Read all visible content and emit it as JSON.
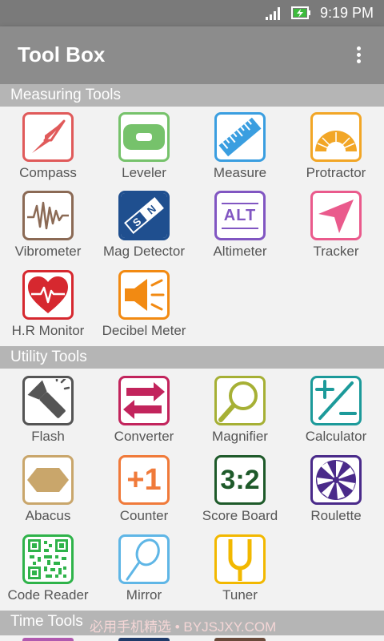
{
  "status_bar": {
    "time": "9:19 PM",
    "signal_icon": "signal-icon",
    "battery_icon": "battery-charging-icon"
  },
  "app_bar": {
    "title": "Tool Box",
    "menu_icon": "more-vert-icon"
  },
  "sections": {
    "measuring": {
      "title": "Measuring Tools",
      "items": [
        {
          "label": "Compass",
          "icon": "compass-icon",
          "color": "#e05a5a"
        },
        {
          "label": "Leveler",
          "icon": "leveler-icon",
          "color": "#76c26b"
        },
        {
          "label": "Measure",
          "icon": "ruler-icon",
          "color": "#3a9ee0"
        },
        {
          "label": "Protractor",
          "icon": "protractor-icon",
          "color": "#f2a626"
        },
        {
          "label": "Vibrometer",
          "icon": "vibrometer-icon",
          "color": "#8b6a55"
        },
        {
          "label": "Mag Detector",
          "icon": "magnet-icon",
          "color": "#1f4f8f"
        },
        {
          "label": "Altimeter",
          "icon": "altimeter-icon",
          "color": "#8156c2"
        },
        {
          "label": "Tracker",
          "icon": "tracker-icon",
          "color": "#ea5a8c"
        },
        {
          "label": "H.R Monitor",
          "icon": "heart-rate-icon",
          "color": "#d6282f"
        },
        {
          "label": "Decibel Meter",
          "icon": "speaker-icon",
          "color": "#f28a12"
        }
      ]
    },
    "utility": {
      "title": "Utility Tools",
      "items": [
        {
          "label": "Flash",
          "icon": "flashlight-icon",
          "color": "#555555"
        },
        {
          "label": "Converter",
          "icon": "converter-icon",
          "color": "#c2245c"
        },
        {
          "label": "Magnifier",
          "icon": "magnifier-icon",
          "color": "#a6b035"
        },
        {
          "label": "Calculator",
          "icon": "calculator-icon",
          "color": "#1c9a9a"
        },
        {
          "label": "Abacus",
          "icon": "abacus-icon",
          "color": "#c9a66b"
        },
        {
          "label": "Counter",
          "icon": "counter-icon",
          "color": "#f07a3a"
        },
        {
          "label": "Score Board",
          "icon": "scoreboard-icon",
          "color": "#1e5a2a"
        },
        {
          "label": "Roulette",
          "icon": "roulette-icon",
          "color": "#4a2a8a"
        },
        {
          "label": "Code Reader",
          "icon": "qr-code-icon",
          "color": "#2fb34a"
        },
        {
          "label": "Mirror",
          "icon": "mirror-icon",
          "color": "#5fb6e6"
        },
        {
          "label": "Tuner",
          "icon": "tuning-fork-icon",
          "color": "#f2b800"
        }
      ]
    },
    "time": {
      "title": "Time Tools"
    }
  },
  "icon_text": {
    "altimeter": "ALT",
    "counter": "+1",
    "scoreboard": "3:2"
  },
  "watermark": "必用手机精选 • BYJSJXY.COM"
}
